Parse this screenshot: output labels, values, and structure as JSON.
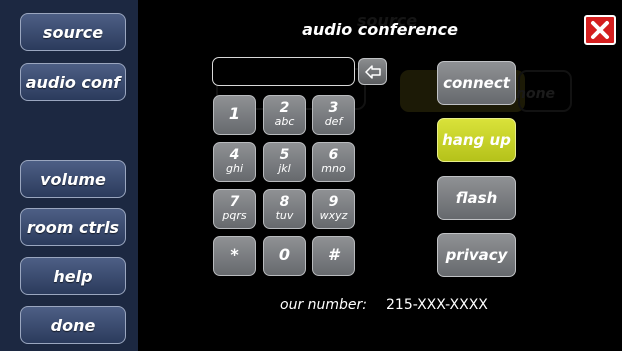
{
  "sidebar": {
    "items": [
      {
        "label": "source"
      },
      {
        "label": "audio conf"
      },
      {
        "label": "volume"
      },
      {
        "label": "room ctrls"
      },
      {
        "label": "help"
      },
      {
        "label": "done"
      }
    ]
  },
  "background_ghost": {
    "title": "source",
    "item": "none"
  },
  "header": {
    "title": "audio conference",
    "close_icon": "close-x-icon"
  },
  "dialpad": {
    "input_value": "",
    "backspace_icon": "backspace-arrow-icon",
    "keys": [
      {
        "digit": "1",
        "letters": ""
      },
      {
        "digit": "2",
        "letters": "abc"
      },
      {
        "digit": "3",
        "letters": "def"
      },
      {
        "digit": "4",
        "letters": "ghi"
      },
      {
        "digit": "5",
        "letters": "jkl"
      },
      {
        "digit": "6",
        "letters": "mno"
      },
      {
        "digit": "7",
        "letters": "pqrs"
      },
      {
        "digit": "8",
        "letters": "tuv"
      },
      {
        "digit": "9",
        "letters": "wxyz"
      },
      {
        "digit": "*",
        "letters": ""
      },
      {
        "digit": "0",
        "letters": ""
      },
      {
        "digit": "#",
        "letters": ""
      }
    ]
  },
  "actions": {
    "connect": "connect",
    "hang_up": "hang up",
    "flash": "flash",
    "privacy": "privacy",
    "active_color": "#c8d22a"
  },
  "footer": {
    "number_label": "our number:",
    "number_value": "215-XXX-XXXX"
  },
  "colors": {
    "sidebar_bg": "#1c2841",
    "main_bg": "#000000",
    "close_red": "#d41f1f"
  }
}
